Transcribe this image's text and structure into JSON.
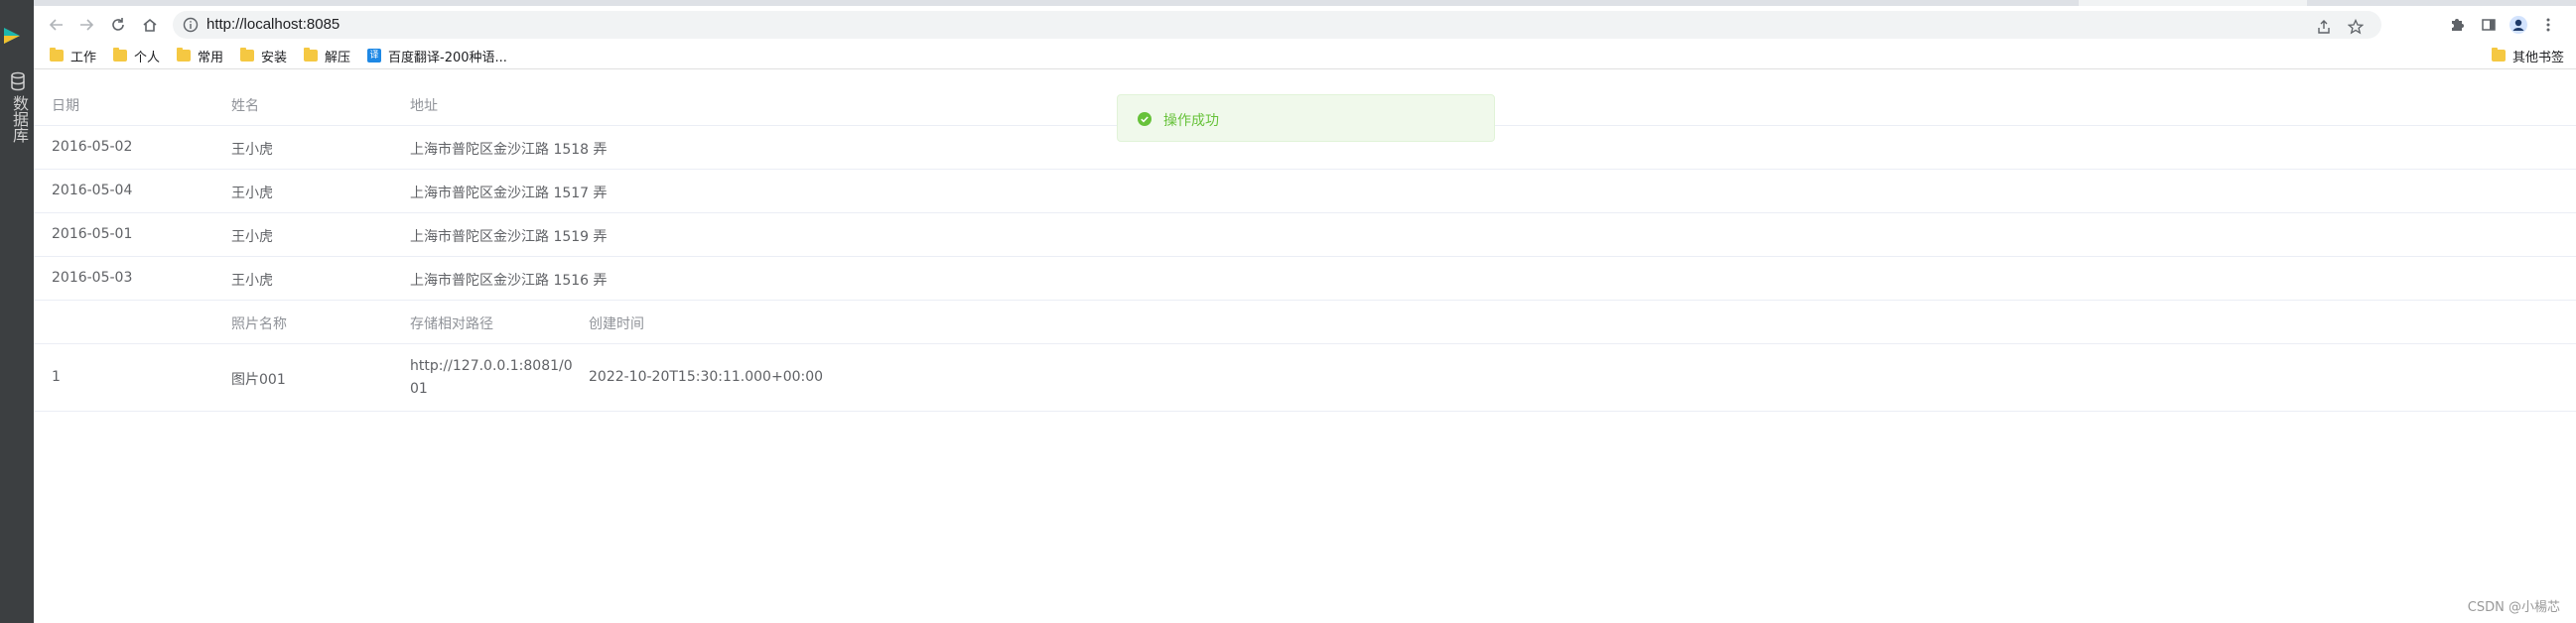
{
  "sidebar": {
    "label": "数据库"
  },
  "browser": {
    "url": "http://localhost:8085",
    "bookmarks": [
      {
        "label": "工作",
        "type": "folder"
      },
      {
        "label": "个人",
        "type": "folder"
      },
      {
        "label": "常用",
        "type": "folder"
      },
      {
        "label": "安装",
        "type": "folder"
      },
      {
        "label": "解压",
        "type": "folder"
      },
      {
        "label": "百度翻译-200种语...",
        "type": "site"
      }
    ],
    "other_bookmarks": "其他书签"
  },
  "table1": {
    "headers": [
      "日期",
      "姓名",
      "地址"
    ],
    "rows": [
      [
        "2016-05-02",
        "王小虎",
        "上海市普陀区金沙江路 1518 弄"
      ],
      [
        "2016-05-04",
        "王小虎",
        "上海市普陀区金沙江路 1517 弄"
      ],
      [
        "2016-05-01",
        "王小虎",
        "上海市普陀区金沙江路 1519 弄"
      ],
      [
        "2016-05-03",
        "王小虎",
        "上海市普陀区金沙江路 1516 弄"
      ]
    ]
  },
  "table2": {
    "headers": [
      "",
      "照片名称",
      "存储相对路径",
      "创建时间"
    ],
    "rows": [
      {
        "id": "1",
        "name": "图片001",
        "path_line1": "http://127.0.0.1:8081/0",
        "path_line2": "01",
        "created": "2022-10-20T15:30:11.000+00:00"
      }
    ]
  },
  "toast": {
    "message": "操作成功",
    "color": "#67c23a"
  },
  "watermark": "CSDN @小楊芯"
}
